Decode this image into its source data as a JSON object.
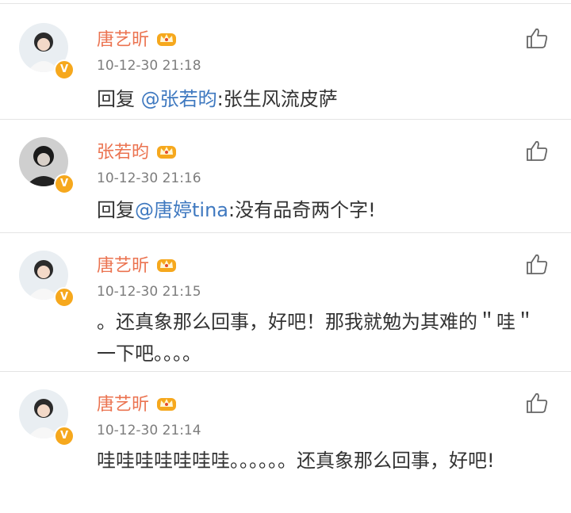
{
  "colors": {
    "username": "#eb7350",
    "mention": "#3f79c0",
    "badge": "#f6a81d",
    "timestamp": "#7d7d7d"
  },
  "comments": [
    {
      "user": "唐艺昕",
      "time": "10-12-30 21:18",
      "reply_prefix": "回复 ",
      "mention": "@张若昀",
      "text": ":张生风流皮萨",
      "badge": "V"
    },
    {
      "user": "张若昀",
      "time": "10-12-30 21:16",
      "reply_prefix": "回复",
      "mention": "@唐婷tina",
      "text": ":没有品奇两个字!",
      "badge": "V"
    },
    {
      "user": "唐艺昕",
      "time": "10-12-30 21:15",
      "text": "。还真象那么回事，好吧！那我就勉为其难的＂哇＂一下吧。。。。",
      "badge": "V"
    },
    {
      "user": "唐艺昕",
      "time": "10-12-30 21:14",
      "text": "哇哇哇哇哇哇哇。。。。。。还真象那么回事，好吧!",
      "badge": "V"
    }
  ],
  "icons": {
    "like": "thumbs-up-icon",
    "crown": "crown-icon",
    "verified": "verified-icon"
  }
}
